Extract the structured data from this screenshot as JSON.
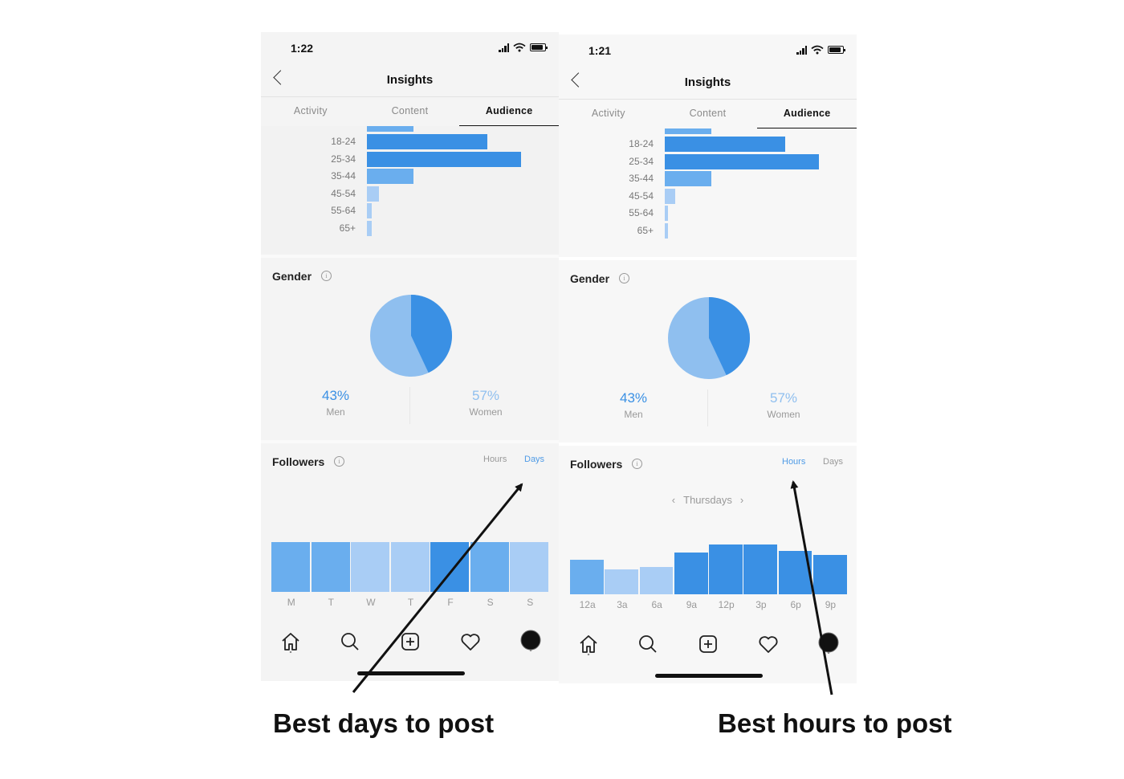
{
  "captions": {
    "left": "Best days to post",
    "right": "Best hours to post"
  },
  "colors": {
    "blue_dark": "#3a90e4",
    "blue_mid": "#6aaeee",
    "blue_light": "#a9cdf5",
    "link_blue": "#4f9be6",
    "women_blue": "#8fbfef"
  },
  "phones": [
    {
      "status_time": "1:22",
      "nav_title": "Insights",
      "tabs": [
        "Activity",
        "Content",
        "Audience"
      ],
      "active_tab": "Audience",
      "age_ranges": {
        "labels": [
          "18-24",
          "25-34",
          "35-44",
          "45-54",
          "55-64",
          "65+"
        ],
        "values": [
          0.78,
          1.0,
          0.3,
          0.08,
          0.03,
          0.03
        ]
      },
      "gender": {
        "title": "Gender",
        "men_pct": "43%",
        "men_label": "Men",
        "women_pct": "57%",
        "women_label": "Women",
        "men_fraction": 0.43
      },
      "followers": {
        "title": "Followers",
        "toggle_hours": "Hours",
        "toggle_days": "Days",
        "selected": "Days",
        "labels": [
          "M",
          "T",
          "W",
          "T",
          "F",
          "S",
          "S"
        ],
        "values": [
          1.0,
          1.0,
          1.0,
          1.0,
          1.0,
          1.0,
          1.0
        ],
        "shades": [
          "mid",
          "mid",
          "light",
          "light",
          "dark",
          "mid",
          "light"
        ]
      }
    },
    {
      "status_time": "1:21",
      "nav_title": "Insights",
      "tabs": [
        "Activity",
        "Content",
        "Audience"
      ],
      "active_tab": "Audience",
      "age_ranges": {
        "labels": [
          "18-24",
          "25-34",
          "35-44",
          "45-54",
          "55-64",
          "65+"
        ],
        "values": [
          0.78,
          1.0,
          0.3,
          0.07,
          0.02,
          0.02
        ]
      },
      "gender": {
        "title": "Gender",
        "men_pct": "43%",
        "men_label": "Men",
        "women_pct": "57%",
        "women_label": "Women",
        "men_fraction": 0.43
      },
      "followers": {
        "title": "Followers",
        "toggle_hours": "Hours",
        "toggle_days": "Days",
        "selected": "Hours",
        "day_nav": "Thursdays",
        "labels": [
          "12a",
          "3a",
          "6a",
          "9a",
          "12p",
          "3p",
          "6p",
          "9p"
        ],
        "values": [
          0.69,
          0.5,
          0.55,
          0.84,
          1.0,
          1.0,
          0.87,
          0.79
        ],
        "shades": [
          "mid",
          "light",
          "light",
          "dark",
          "dark",
          "dark",
          "dark",
          "dark"
        ]
      }
    }
  ]
}
